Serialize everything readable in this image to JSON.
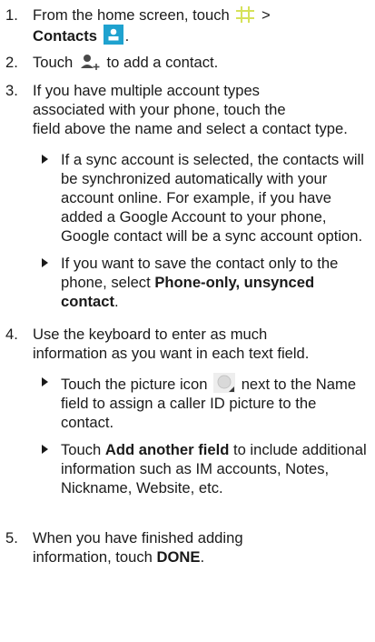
{
  "steps": [
    {
      "num": "1.",
      "pre": "From the home screen, touch",
      "sep": ">",
      "bold": "Contacts",
      "post": "."
    },
    {
      "num": "2.",
      "pre": "Touch",
      "post": "to add a contact."
    },
    {
      "num": "3.",
      "line1": "If you have multiple account types",
      "line2": "associated with your phone, touch the",
      "line3": "field above the name and select a contact type."
    },
    {
      "num": "4.",
      "line1": "Use the keyboard to enter as much",
      "line2": "information as you want in each text field."
    },
    {
      "num": "5.",
      "line1": "When you have finished adding",
      "pre": "information, touch",
      "bold": "DONE",
      "post": "."
    }
  ],
  "bullets3": [
    {
      "text": "If a sync account is selected, the contacts will be synchronized automatically with your account online. For example, if you have added a Google Account to your phone, Google contact will be a sync account option."
    },
    {
      "pre": "If you want to save the contact only to the phone, select",
      "bold": "Phone-only, unsynced contact",
      "post": "."
    }
  ],
  "bullets4": [
    {
      "pre": "Touch the picture icon",
      "post": "next to the Name field to assign a caller ID picture to the contact."
    },
    {
      "pre": "Touch",
      "bold": "Add another field",
      "post": "to include additional information such as IM accounts, Notes, Nickname, Website, etc."
    }
  ],
  "icons": {
    "apps": "apps-grid-icon",
    "contacts": "contacts-app-icon",
    "add_contact": "add-contact-icon",
    "picture": "contact-picture-icon"
  },
  "colors": {
    "apps_grid": "#d6e25a",
    "contacts_bg": "#1fa2cf",
    "icon_gray": "#4a4a4a"
  }
}
